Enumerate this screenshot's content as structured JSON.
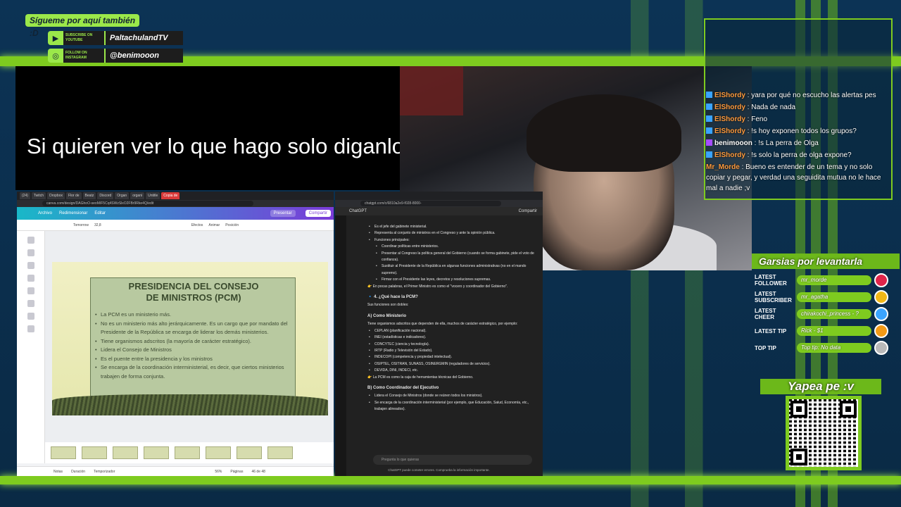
{
  "overlay": {
    "follow_tag": "Sígueme por aquí también :D",
    "youtube": {
      "small": "SUBSCRIBE ON YOUTUBE",
      "handle": "PaltachulandTV"
    },
    "instagram": {
      "small": "FOLLOW ON INSTAGRAM",
      "handle": "@benimooon"
    },
    "caption": "Si quieren ver lo que hago solo diganlo :v",
    "goal": "Garsias por levantarla",
    "alerts": [
      {
        "label": "LATEST FOLLOWER",
        "value": "mr_morde",
        "color": "#e0254a"
      },
      {
        "label": "LATEST SUBSCRIBER",
        "value": "mr_agatha",
        "color": "#f2b817"
      },
      {
        "label": "LATEST CHEER",
        "value": "chirakochi_princess - ?",
        "color": "#3aa4ff"
      },
      {
        "label": "LATEST TIP",
        "value": "Rick - $1",
        "color": "#f29a17"
      },
      {
        "label": "TOP TIP",
        "value": "Top tip: No data",
        "color": "#b9b9b9"
      }
    ],
    "yapea": "Yapea pe :v"
  },
  "chat": {
    "messages": [
      {
        "user": "ElShordy",
        "text": "yara por qué no escucho las alertas pes",
        "color": "#ff9a3c"
      },
      {
        "user": "ElShordy",
        "text": "Nada de nada",
        "color": "#ff9a3c"
      },
      {
        "user": "ElShordy",
        "text": "Feno",
        "color": "#ff9a3c"
      },
      {
        "user": "ElShordy",
        "text": "!s hoy exponen todos los grupos?",
        "color": "#ff9a3c"
      },
      {
        "user": "benimooon",
        "text": "!s La perra de Olga",
        "color": "#ffffff"
      },
      {
        "user": "ElShordy",
        "text": "!s solo la perra de olga expone?",
        "color": "#ff9a3c"
      },
      {
        "user": "Mr_Morde",
        "text": "Bueno es entender de un tema y no solo copiar y pegar, y verdad una seguidita mutua no le hace mal a nadie ;v",
        "color": "#ff9a3c"
      }
    ]
  },
  "canva": {
    "tabs": [
      "(24)",
      "Twitch",
      "Dropbox",
      "Flor de",
      "Beatz",
      "Discord",
      "Organ",
      "organi",
      "Untitle",
      "Copia de"
    ],
    "url": "canva.com/design/DAGhoO-seoM/F5Cq4SWzSlxO2FBr9Rke4Q/edit",
    "menu": [
      "Archivo",
      "Redimensionar",
      "Editar"
    ],
    "present": "Presentar",
    "share": "Compartir",
    "font": "Tomorrow",
    "size": "32,8",
    "toolbar_right": [
      "Efectos",
      "Animar",
      "Posición"
    ],
    "slide": {
      "title": "PRESIDENCIA DEL CONSEJO\nDE MINISTROS (PCM)",
      "bullets": [
        "La PCM es un ministerio más.",
        "No es un ministerio más alto jerárquicamente. Es un cargo que por mandato del Presidente de la República se encarga de liderar los demás ministerios.",
        "Tiene organismos adscritos (la mayoría de carácter estratégico).",
        "Lidera el Consejo de Ministros",
        "Es el puente entre la presidencia y los ministros",
        "Se encarga de la coordinación interministerial, es decir, que ciertos ministerios trabajen de forma conjunta."
      ]
    },
    "status": [
      "Notas",
      "Duración",
      "Temporizador",
      "56%",
      "Páginas",
      "46 de 48"
    ]
  },
  "gpt": {
    "title": "ChatGPT",
    "share": "Compartir",
    "url": "chatgpt.com/c/6810a2e9-f028-8000-",
    "lines": [
      {
        "k": "li",
        "t": "Es el jefe del gabinete ministerial."
      },
      {
        "k": "li",
        "t": "Representa al conjunto de ministros en el Congreso y ante la opinión pública."
      },
      {
        "k": "li",
        "t": "Funciones principales:"
      },
      {
        "k": "li2",
        "t": "Coordinar políticas entre ministerios."
      },
      {
        "k": "li2",
        "t": "Presentar al Congreso la política general del Gobierno (cuando se forma gabinete, pide el voto de confianza)."
      },
      {
        "k": "li2",
        "t": "Sustituir al Presidente de la República en algunas funciones administrativas (no en el mando supremo)."
      },
      {
        "k": "li2",
        "t": "Firmar con el Presidente las leyes, decretos y resoluciones supremas."
      },
      {
        "k": "p",
        "t": "👉 En pocas palabras, el Primer Ministro es como el \"vocero y coordinador del Gobierno\"."
      },
      {
        "k": "h",
        "t": "🔹 4. ¿Qué hace la PCM?"
      },
      {
        "k": "p",
        "t": "Sus funciones son dobles:"
      },
      {
        "k": "h",
        "t": "A) Como Ministerio"
      },
      {
        "k": "p",
        "t": "Tiene organismos adscritos que dependen de ella, muchos de carácter estratégico, por ejemplo:"
      },
      {
        "k": "li",
        "t": "CEPLAN (planificación nacional)."
      },
      {
        "k": "li",
        "t": "INEI (estadísticas e indicadores)."
      },
      {
        "k": "li",
        "t": "CONCYTEC (ciencia y tecnología)."
      },
      {
        "k": "li",
        "t": "IRTP (Radio y Televisión del Estado)."
      },
      {
        "k": "li",
        "t": "INDECOPI (competencia y propiedad intelectual)."
      },
      {
        "k": "li",
        "t": "OSIPTEL, OSITRAN, SUNASS, OSINERGMIN (reguladores de servicios)."
      },
      {
        "k": "li",
        "t": "DEVIDA, DINI, INDECI, etc."
      },
      {
        "k": "p",
        "t": "👉 La PCM es como la caja de herramientas técnicas del Gobierno."
      },
      {
        "k": "h",
        "t": "B) Como Coordinador del Ejecutivo"
      },
      {
        "k": "li",
        "t": "Lidera el Consejo de Ministros (donde se reúnen todos los ministros)."
      },
      {
        "k": "li",
        "t": "Se encarga de la coordinación interministerial (por ejemplo, que Educación, Salud, Economía, etc., trabajen alineados)."
      }
    ],
    "input_placeholder": "Pregunta lo que quieras",
    "footer": "ChatGPT puede cometer errores. Comprueba la información importante."
  }
}
